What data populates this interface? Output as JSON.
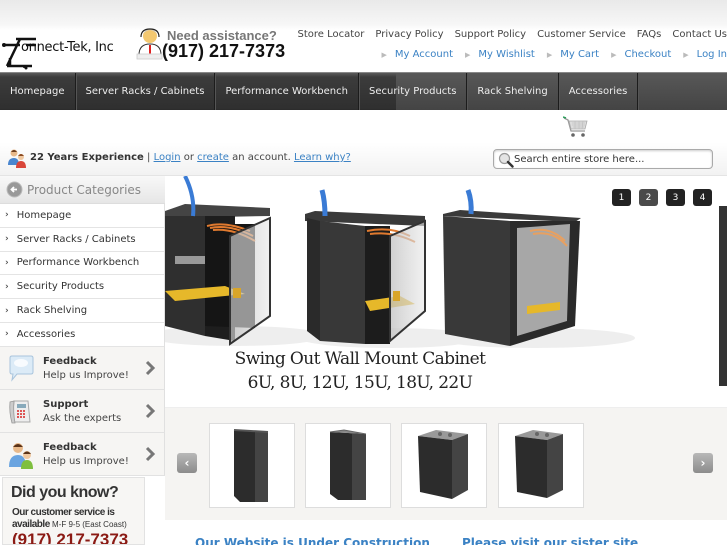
{
  "header": {
    "logo_text": "onnect-Tek, Inc",
    "assistance_title": "Need assistance?",
    "assistance_phone": "(917) 217-7373",
    "top_links": [
      "Store Locator",
      "Privacy Policy",
      "Support Policy",
      "Customer Service",
      "FAQs",
      "Contact Us"
    ],
    "account_links": [
      "My Account",
      "My Wishlist",
      "My Cart",
      "Checkout",
      "Log In"
    ]
  },
  "nav": {
    "items": [
      "Homepage",
      "Server Racks / Cabinets",
      "Performance Workbench",
      "Security Products",
      "Rack Shelving",
      "Accessories"
    ]
  },
  "welcome": {
    "experience": "22 Years Experience",
    "separator": "|",
    "login": "Login",
    "or": "or",
    "create": "create",
    "account_text": "an account.",
    "learn_why": "Learn why?"
  },
  "search": {
    "placeholder": "Search entire store here..."
  },
  "sidebar": {
    "heading": "Product Categories",
    "categories": [
      "Homepage",
      "Server Racks / Cabinets",
      "Performance Workbench",
      "Security Products",
      "Rack Shelving",
      "Accessories"
    ],
    "promos": [
      {
        "title": "Feedback",
        "subtitle": "Help us Improve!",
        "icon": "speech-bubble-icon"
      },
      {
        "title": "Support",
        "subtitle": "Ask the experts",
        "icon": "telephone-icon"
      },
      {
        "title": "Feedback",
        "subtitle": "Help us Improve!",
        "icon": "people-icon"
      }
    ],
    "did_you_know": {
      "heading": "Did you know?",
      "line1": "Our customer service is",
      "line2_bold": "available",
      "line2_small": "M-F  9-5 (East Coast)",
      "phone": "(917) 217-7373"
    }
  },
  "slider": {
    "title_line1": "Swing Out Wall Mount Cabinet",
    "title_line2": "6U, 8U, 12U, 15U, 18U, 22U",
    "pages": [
      "1",
      "2",
      "3",
      "4"
    ],
    "active_page": "2"
  },
  "carousel": {
    "prev": "‹",
    "next": "›",
    "thumb_count": 4
  },
  "bottom": {
    "text1": "Our Website is Under Construction",
    "text2": "Please visit our sister site"
  }
}
